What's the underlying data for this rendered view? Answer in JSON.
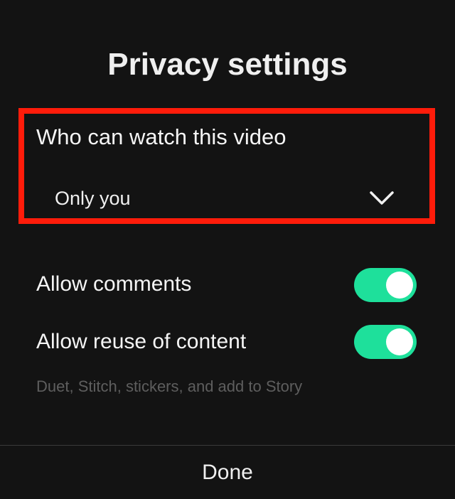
{
  "title": "Privacy settings",
  "visibility": {
    "label": "Who can watch this video",
    "selected": "Only you",
    "icon": "chevron-down-icon"
  },
  "toggles": [
    {
      "label": "Allow comments",
      "on": true
    },
    {
      "label": "Allow reuse of content",
      "on": true
    }
  ],
  "reuse_hint": "Duet, Stitch, stickers, and add to Story",
  "done_label": "Done",
  "colors": {
    "background": "#131313",
    "toggle_on": "#1ee09b",
    "highlight": "#ff1c0a"
  }
}
